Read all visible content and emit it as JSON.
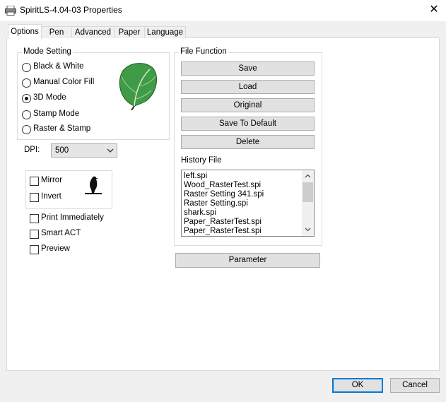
{
  "window": {
    "title": "SpiritLS-4.04-03 Properties"
  },
  "tabs": [
    {
      "label": "Options"
    },
    {
      "label": "Pen"
    },
    {
      "label": "Advanced"
    },
    {
      "label": "Paper"
    },
    {
      "label": "Language"
    }
  ],
  "mode_setting": {
    "label": "Mode Setting",
    "options": [
      "Black & White",
      "Manual Color Fill",
      "3D Mode",
      "Stamp Mode",
      "Raster & Stamp"
    ],
    "selected": "3D Mode"
  },
  "dpi": {
    "label": "DPI:",
    "value": "500"
  },
  "mirror_group": {
    "mirror_label": "Mirror",
    "invert_label": "Invert"
  },
  "options": {
    "print_immediately": "Print Immediately",
    "smart_act": "Smart ACT",
    "preview": "Preview"
  },
  "file_function": {
    "label": "File Function",
    "buttons": [
      "Save",
      "Load",
      "Original",
      "Save To Default",
      "Delete"
    ],
    "history_label": "History File",
    "history_files": [
      "left.spi",
      "Wood_RasterTest.spi",
      "Raster Setting 341.spi",
      "Raster Setting.spi",
      "shark.spi",
      "Paper_RasterTest.spi",
      "Paper_RasterTest.spi"
    ]
  },
  "parameter_button": "Parameter",
  "footer": {
    "ok": "OK",
    "cancel": "Cancel"
  },
  "colors": {
    "accent": "#0078d7",
    "leaf": "#3f9b46"
  }
}
